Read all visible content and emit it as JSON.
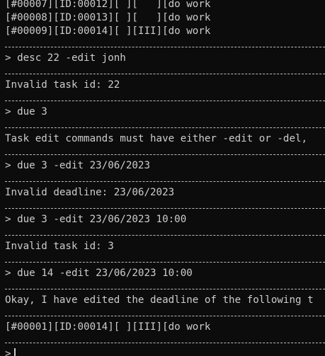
{
  "terminal": {
    "colors": {
      "background": "#0c0c0c",
      "foreground": "#cccccc"
    },
    "lines": [
      {
        "type": "text",
        "text": "[#00007][ID:00012][ ][   ][do work"
      },
      {
        "type": "text",
        "text": "[#00008][ID:00013][ ][   ][do work"
      },
      {
        "type": "text",
        "text": "[#00009][ID:00014][ ][III][do work"
      },
      {
        "type": "sep"
      },
      {
        "type": "text",
        "text": "> desc 22 -edit jonh"
      },
      {
        "type": "sep"
      },
      {
        "type": "text",
        "text": "Invalid task id: 22"
      },
      {
        "type": "sep"
      },
      {
        "type": "text",
        "text": "> due 3"
      },
      {
        "type": "sep"
      },
      {
        "type": "text",
        "text": "Task edit commands must have either -edit or -del,"
      },
      {
        "type": "sep"
      },
      {
        "type": "text",
        "text": "> due 3 -edit 23/06/2023"
      },
      {
        "type": "sep"
      },
      {
        "type": "text",
        "text": "Invalid deadline: 23/06/2023"
      },
      {
        "type": "sep"
      },
      {
        "type": "text",
        "text": "> due 3 -edit 23/06/2023 10:00"
      },
      {
        "type": "sep"
      },
      {
        "type": "text",
        "text": "Invalid task id: 3"
      },
      {
        "type": "sep"
      },
      {
        "type": "text",
        "text": "> due 14 -edit 23/06/2023 10:00"
      },
      {
        "type": "sep"
      },
      {
        "type": "text",
        "text": "Okay, I have edited the deadline of the following t"
      },
      {
        "type": "sep"
      },
      {
        "type": "text",
        "text": "[#00001][ID:00014][ ][III][do work"
      },
      {
        "type": "sep"
      },
      {
        "type": "prompt",
        "text": ">"
      }
    ]
  }
}
